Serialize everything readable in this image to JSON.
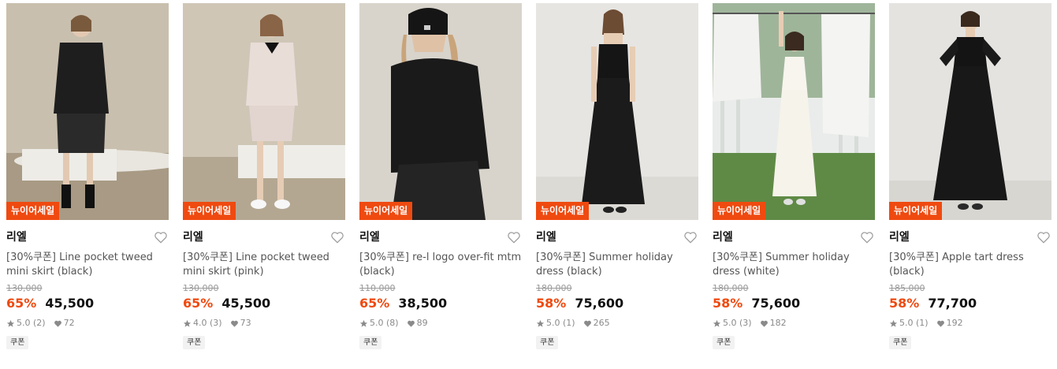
{
  "products": [
    {
      "badge": "뉴이어세일",
      "brand": "리엘",
      "name": "[30%쿠폰] Line pocket tweed mini skirt (black)",
      "original_price": "130,000",
      "discount": "65%",
      "price": "45,500",
      "rating": "5.0 (2)",
      "likes": "72",
      "coupon": "쿠폰",
      "image_desc": "model-black-tweed"
    },
    {
      "badge": "뉴이어세일",
      "brand": "리엘",
      "name": "[30%쿠폰] Line pocket tweed mini skirt (pink)",
      "original_price": "130,000",
      "discount": "65%",
      "price": "45,500",
      "rating": "4.0 (3)",
      "likes": "73",
      "coupon": "쿠폰",
      "image_desc": "model-pink-tweed"
    },
    {
      "badge": "뉴이어세일",
      "brand": "리엘",
      "name": "[30%쿠폰] re-l logo over-fit mtm (black)",
      "original_price": "110,000",
      "discount": "65%",
      "price": "38,500",
      "rating": "5.0 (8)",
      "likes": "89",
      "coupon": "쿠폰",
      "image_desc": "model-black-sweatshirt"
    },
    {
      "badge": "뉴이어세일",
      "brand": "리엘",
      "name": "[30%쿠폰] Summer holiday dress (black)",
      "original_price": "180,000",
      "discount": "58%",
      "price": "75,600",
      "rating": "5.0 (1)",
      "likes": "265",
      "coupon": "쿠폰",
      "image_desc": "model-black-dress"
    },
    {
      "badge": "뉴이어세일",
      "brand": "리엘",
      "name": "[30%쿠폰] Summer holiday dress (white)",
      "original_price": "180,000",
      "discount": "58%",
      "price": "75,600",
      "rating": "5.0 (3)",
      "likes": "182",
      "coupon": "쿠폰",
      "image_desc": "model-white-dress-garden"
    },
    {
      "badge": "뉴이어세일",
      "brand": "리엘",
      "name": "[30%쿠폰] Apple tart dress (black)",
      "original_price": "185,000",
      "discount": "58%",
      "price": "77,700",
      "rating": "5.0 (1)",
      "likes": "192",
      "coupon": "쿠폰",
      "image_desc": "model-black-long-dress"
    }
  ],
  "colors": {
    "accent": "#ef4a10",
    "muted": "#9a9a9a"
  }
}
